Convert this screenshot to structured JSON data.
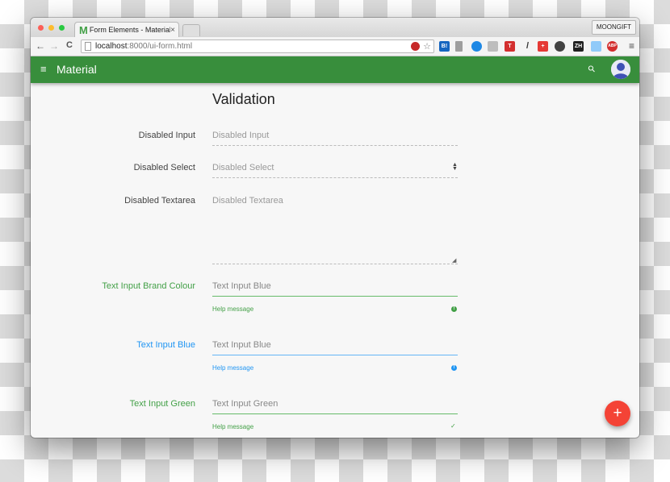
{
  "browser": {
    "tab_logo": "M",
    "tab_title": "Form Elements - Material",
    "tab_close": "×",
    "profile": "MOONGIFT",
    "url_host": "localhost",
    "url_path": ":8000/ui-form.html",
    "back": "←",
    "forward": "→",
    "reload": "C",
    "star": "☆",
    "menu": "≡",
    "extensions": [
      "B!",
      "T",
      "ZH",
      "ABP",
      "19"
    ]
  },
  "app": {
    "menu_icon": "≡",
    "title": "Material",
    "search_icon": "⚲",
    "fab_label": "+"
  },
  "form": {
    "heading": "Validation",
    "disabled_input": {
      "label": "Disabled Input",
      "placeholder": "Disabled Input"
    },
    "disabled_select": {
      "label": "Disabled Select",
      "value": "Disabled Select",
      "arrows": "▲\n▼"
    },
    "disabled_textarea": {
      "label": "Disabled Textarea",
      "placeholder": "Disabled Textarea"
    },
    "brand": {
      "label": "Text Input Brand Colour",
      "placeholder": "Text Input Blue",
      "help": "Help message",
      "icon": "!"
    },
    "blue": {
      "label": "Text Input Blue",
      "placeholder": "Text Input Blue",
      "help": "Help message",
      "icon": "!"
    },
    "green": {
      "label": "Text Input Green",
      "placeholder": "Text Input Green",
      "help": "Help message",
      "icon": "✓"
    }
  },
  "colors": {
    "appbar": "#388e3c",
    "green": "#43a047",
    "blue": "#2196f3",
    "fab": "#f44336"
  }
}
